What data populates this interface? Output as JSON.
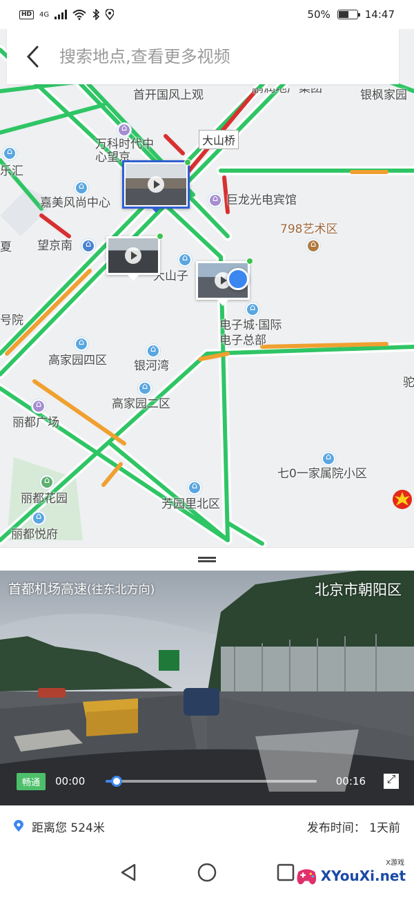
{
  "status_bar": {
    "network": "4G",
    "battery_text": "50%",
    "battery_level": 0.5,
    "time": "14:47"
  },
  "search": {
    "placeholder": "搜索地点,查看更多视频"
  },
  "map": {
    "road_label": "大山桥",
    "pois": [
      {
        "name": "首开国风上观",
        "icon": "none"
      },
      {
        "name": "鹏润地产集团",
        "icon": "none"
      },
      {
        "name": "银枫家园",
        "icon": "none"
      },
      {
        "name": "万科时代中心望京",
        "icon": "purple"
      },
      {
        "name": "乐汇",
        "icon": "home"
      },
      {
        "name": "嘉美风尚中心",
        "icon": "home"
      },
      {
        "name": "巨龙光电宾馆",
        "icon": "purple"
      },
      {
        "name": "798艺术区",
        "icon": "brown"
      },
      {
        "name": "望京南",
        "icon": "metro"
      },
      {
        "name": "夏",
        "icon": "none"
      },
      {
        "name": "大山子",
        "icon": "home"
      },
      {
        "name": "号院",
        "icon": "none"
      },
      {
        "name": "电子城·国际电子总部",
        "icon": "home"
      },
      {
        "name": "高家园四区",
        "icon": "home"
      },
      {
        "name": "银河湾",
        "icon": "home"
      },
      {
        "name": "驼",
        "icon": "none"
      },
      {
        "name": "高家园二区",
        "icon": "home"
      },
      {
        "name": "丽都广场",
        "icon": "purple"
      },
      {
        "name": "七0一家属院小区",
        "icon": "home"
      },
      {
        "name": "丽都花园",
        "icon": "green"
      },
      {
        "name": "芳园里北区",
        "icon": "home"
      },
      {
        "name": "丽都悦府",
        "icon": "home"
      }
    ]
  },
  "video": {
    "title_main": "首都机场高速",
    "title_dir": "(往东北方向)",
    "location": "北京市朝阳区",
    "status_badge": "畅通",
    "current_time": "00:00",
    "duration": "00:16",
    "progress": 0.05
  },
  "info": {
    "distance": "距离您 524米",
    "publish": "发布时间： 1天前"
  },
  "watermark": {
    "text": "XYouXi.net",
    "small": "X游戏"
  },
  "icons": {
    "back": "chevron-left-icon",
    "pin": "location-pin-icon",
    "fullscreen": "expand-icon"
  }
}
